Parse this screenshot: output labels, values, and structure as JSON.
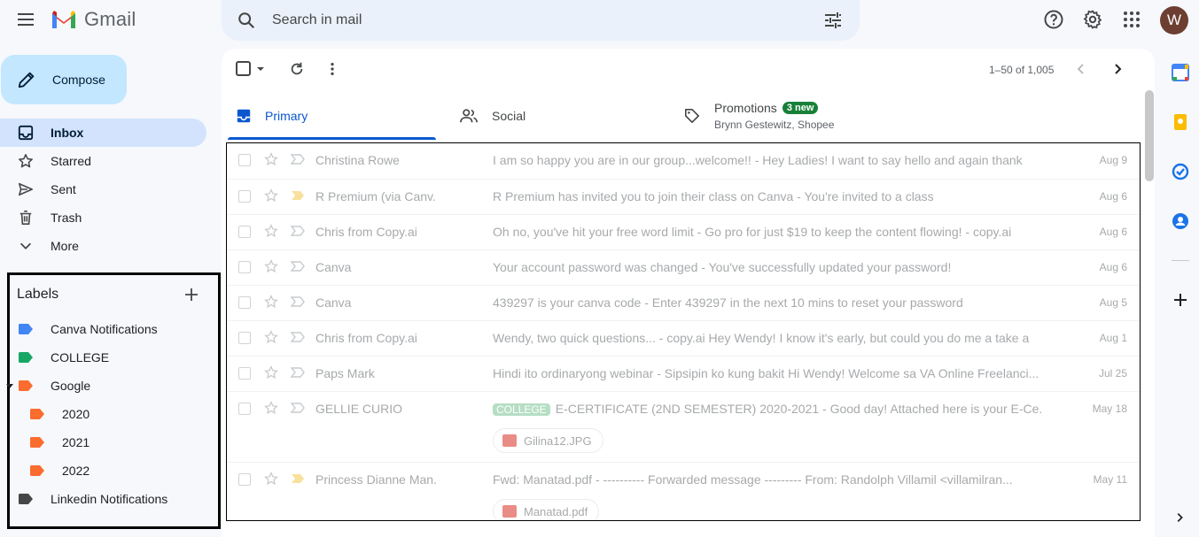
{
  "app": {
    "name": "Gmail",
    "account_initial": "W"
  },
  "search": {
    "placeholder": "Search in mail"
  },
  "compose": {
    "label": "Compose"
  },
  "nav": [
    {
      "label": "Inbox",
      "icon": "inbox-icon",
      "active": true
    },
    {
      "label": "Starred",
      "icon": "star-icon"
    },
    {
      "label": "Sent",
      "icon": "send-icon"
    },
    {
      "label": "Trash",
      "icon": "trash-icon"
    },
    {
      "label": "More",
      "icon": "chevron-down-icon"
    }
  ],
  "labels": {
    "title": "Labels",
    "items": [
      {
        "label": "Canva Notifications",
        "color": "#4285f4"
      },
      {
        "label": "COLLEGE",
        "color": "#16a765"
      },
      {
        "label": "Google",
        "color": "#fb4c2f"
      },
      {
        "label": "2020",
        "color": "#fb4c2f"
      },
      {
        "label": "2021",
        "color": "#fb4c2f"
      },
      {
        "label": "2022",
        "color": "#fb4c2f"
      },
      {
        "label": "Linkedin Notifications",
        "color": "#444746"
      }
    ]
  },
  "pager": {
    "text": "1–50 of 1,005"
  },
  "tabs": {
    "primary": "Primary",
    "social": "Social",
    "promotions": "Promotions",
    "promotions_badge": "3 new",
    "promotions_senders": "Brynn Gestewitz, Shopee"
  },
  "emails": [
    {
      "sender": "Christina Rowe",
      "subject": "I am so happy you are in our group...welcome!! - Hey Ladies! I want to say hello and again thank",
      "date": "Aug 9"
    },
    {
      "sender": "R Premium (via Canv.",
      "subject": "R Premium has invited you to join their class on Canva - You're invited to a class",
      "date": "Aug 6"
    },
    {
      "sender": "Chris from Copy.ai",
      "subject": "Oh no, you've hit your free word limit - Go pro for just $19 to keep the content flowing! - copy.ai",
      "date": "Aug 6"
    },
    {
      "sender": "Canva",
      "subject": "Your account password was changed - You've successfully updated your password!",
      "date": "Aug 6"
    },
    {
      "sender": "Canva",
      "subject": "439297 is your canva code - Enter 439297 in the next 10 mins to reset your password",
      "date": "Aug 5"
    },
    {
      "sender": "Chris from Copy.ai",
      "subject": "Wendy, two quick questions... - copy.ai Hey Wendy! I know it's early, but could you do me a take a",
      "date": "Aug 1"
    },
    {
      "sender": "Paps Mark",
      "subject": "Hindi ito ordinaryong webinar - Sipsipin ko kung bakit Hi Wendy! Welcome sa VA Online Freelanci...",
      "date": "Jul 25"
    },
    {
      "sender": "GELLIE CURIO",
      "tag": "COLLEGE",
      "subject": "E-CERTIFICATE (2ND SEMESTER) 2020-2021 - Good day! Attached here is your E-Ce...",
      "date": "May 18",
      "attachment": "Gilina12.JPG"
    },
    {
      "sender": "Princess Dianne Man.",
      "subject": "Fwd: Manatad.pdf - ---------- Forwarded message --------- From: Randolph Villamil <villamilran...",
      "date": "May 11",
      "attachment": "Manatad.pdf"
    }
  ]
}
